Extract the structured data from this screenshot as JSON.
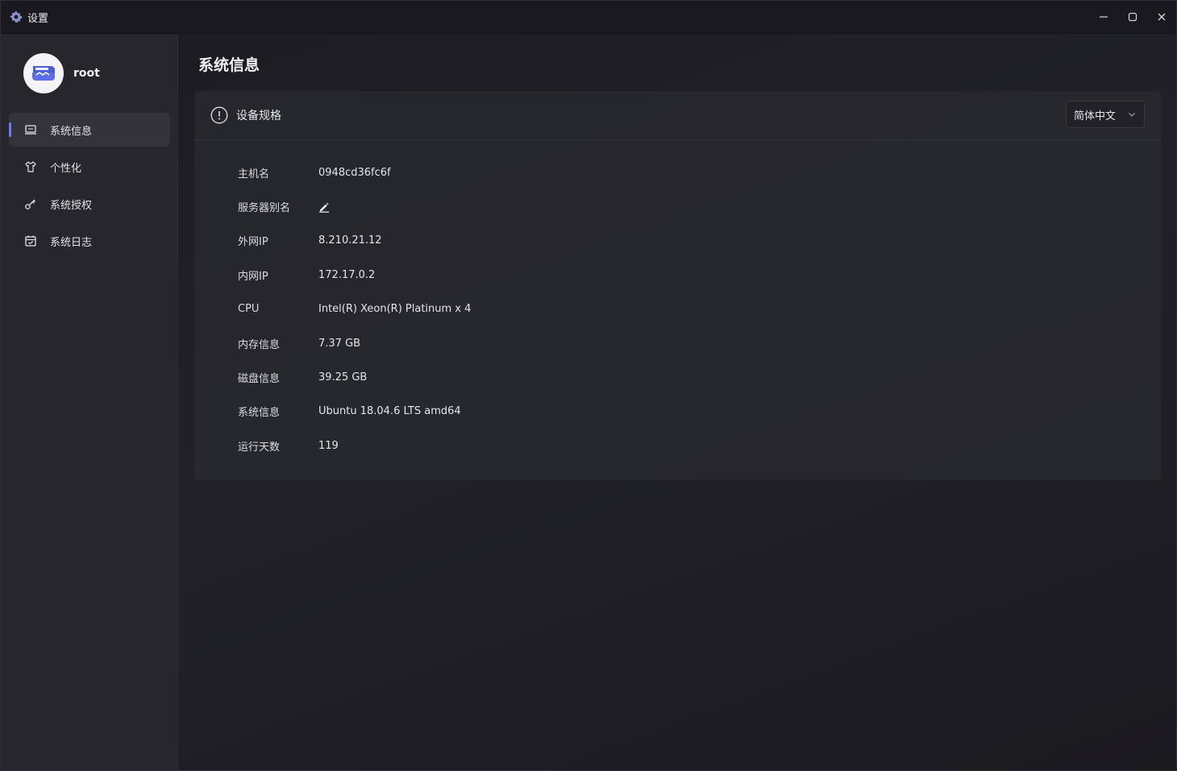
{
  "window": {
    "title": "设置",
    "controls": [
      "minimize-icon",
      "maximize-icon",
      "close-icon"
    ]
  },
  "sidebar": {
    "user": {
      "name": "root"
    },
    "items": [
      {
        "label": "系统信息",
        "icon": "monitor-icon",
        "active": true
      },
      {
        "label": "个性化",
        "icon": "shirt-icon",
        "active": false
      },
      {
        "label": "系统授权",
        "icon": "key-icon",
        "active": false
      },
      {
        "label": "系统日志",
        "icon": "calendar-icon",
        "active": false
      }
    ]
  },
  "main": {
    "title": "系统信息",
    "card": {
      "title": "设备规格",
      "language": {
        "selected": "简体中文"
      },
      "rows": [
        {
          "label": "主机名",
          "value": "0948cd36fc6f"
        },
        {
          "label": "服务器别名",
          "value": "",
          "icon": "edit-icon"
        },
        {
          "label": "外网IP",
          "value": "8.210.21.12"
        },
        {
          "label": "内网IP",
          "value": "172.17.0.2"
        },
        {
          "label": "CPU",
          "value": "Intel(R) Xeon(R) Platinum x 4"
        },
        {
          "label": "内存信息",
          "value": "7.37 GB"
        },
        {
          "label": "磁盘信息",
          "value": "39.25 GB"
        },
        {
          "label": "系统信息",
          "value": "Ubuntu 18.04.6 LTS amd64"
        },
        {
          "label": "运行天数",
          "value": "119"
        }
      ]
    }
  },
  "colors": {
    "accent": "#6b7cf2",
    "sidebar_bg": "#27262c",
    "main_bg": "#1d1c22"
  }
}
